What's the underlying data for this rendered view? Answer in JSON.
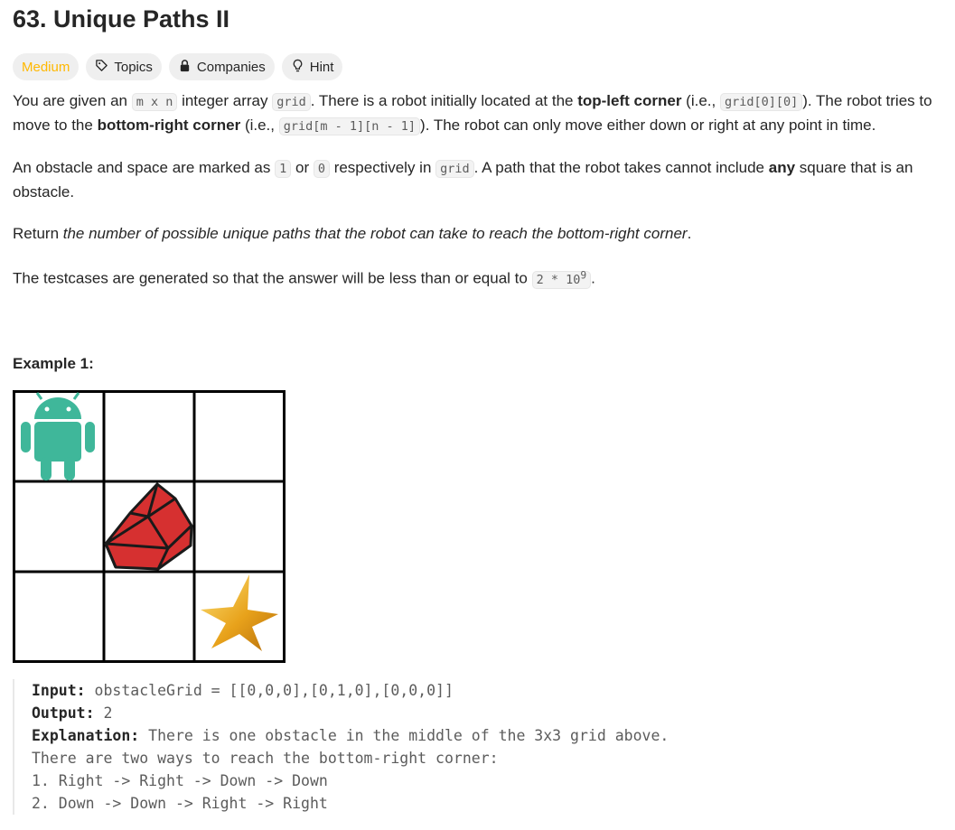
{
  "problem": {
    "title": "63. Unique Paths II",
    "tags": {
      "difficulty": "Medium",
      "topics": "Topics",
      "companies": "Companies",
      "hint": "Hint"
    },
    "colors": {
      "difficulty": "#ffb800",
      "robot": "#3fb79a",
      "obstacle": "#d63030",
      "star": "#e8a21b"
    },
    "icons": [
      "tag-icon",
      "lock-icon",
      "lightbulb-icon",
      "robot-icon",
      "obstacle-gem-icon",
      "star-icon"
    ],
    "p1": {
      "t1": "You are given an ",
      "c1": "m x n",
      "t2": " integer array ",
      "c2": "grid",
      "t3": ". There is a robot initially located at the ",
      "b1": "top-left corner",
      "t4": " (i.e., ",
      "c3": "grid[0][0]",
      "t5": "). The robot tries to move to the ",
      "b2": "bottom-right corner",
      "t6": " (i.e., ",
      "c4": "grid[m - 1][n - 1]",
      "t7": "). The robot can only move either down or right at any point in time."
    },
    "p2": {
      "t1": "An obstacle and space are marked as ",
      "c1": "1",
      "t2": " or ",
      "c2": "0",
      "t3": " respectively in ",
      "c3": "grid",
      "t4": ". A path that the robot takes cannot include ",
      "b1": "any",
      "t5": " square that is an obstacle."
    },
    "p3": {
      "t1": "Return ",
      "i1": "the number of possible unique paths that the robot can take to reach the bottom-right corner",
      "t2": "."
    },
    "p4": {
      "t1": "The testcases are generated so that the answer will be less than or equal to ",
      "c1": "2 * 10",
      "sup": "9",
      "t2": "."
    },
    "example": {
      "title": "Example 1:",
      "input_label": "Input:",
      "input_value": " obstacleGrid = [[0,0,0],[0,1,0],[0,0,0]]",
      "output_label": "Output:",
      "output_value": " 2",
      "explanation_label": "Explanation:",
      "explanation_value": " There is one obstacle in the middle of the 3x3 grid above.",
      "line2": "There are two ways to reach the bottom-right corner:",
      "line3": "1. Right -> Right -> Down -> Down",
      "line4": "2. Down -> Down -> Right -> Right"
    }
  }
}
